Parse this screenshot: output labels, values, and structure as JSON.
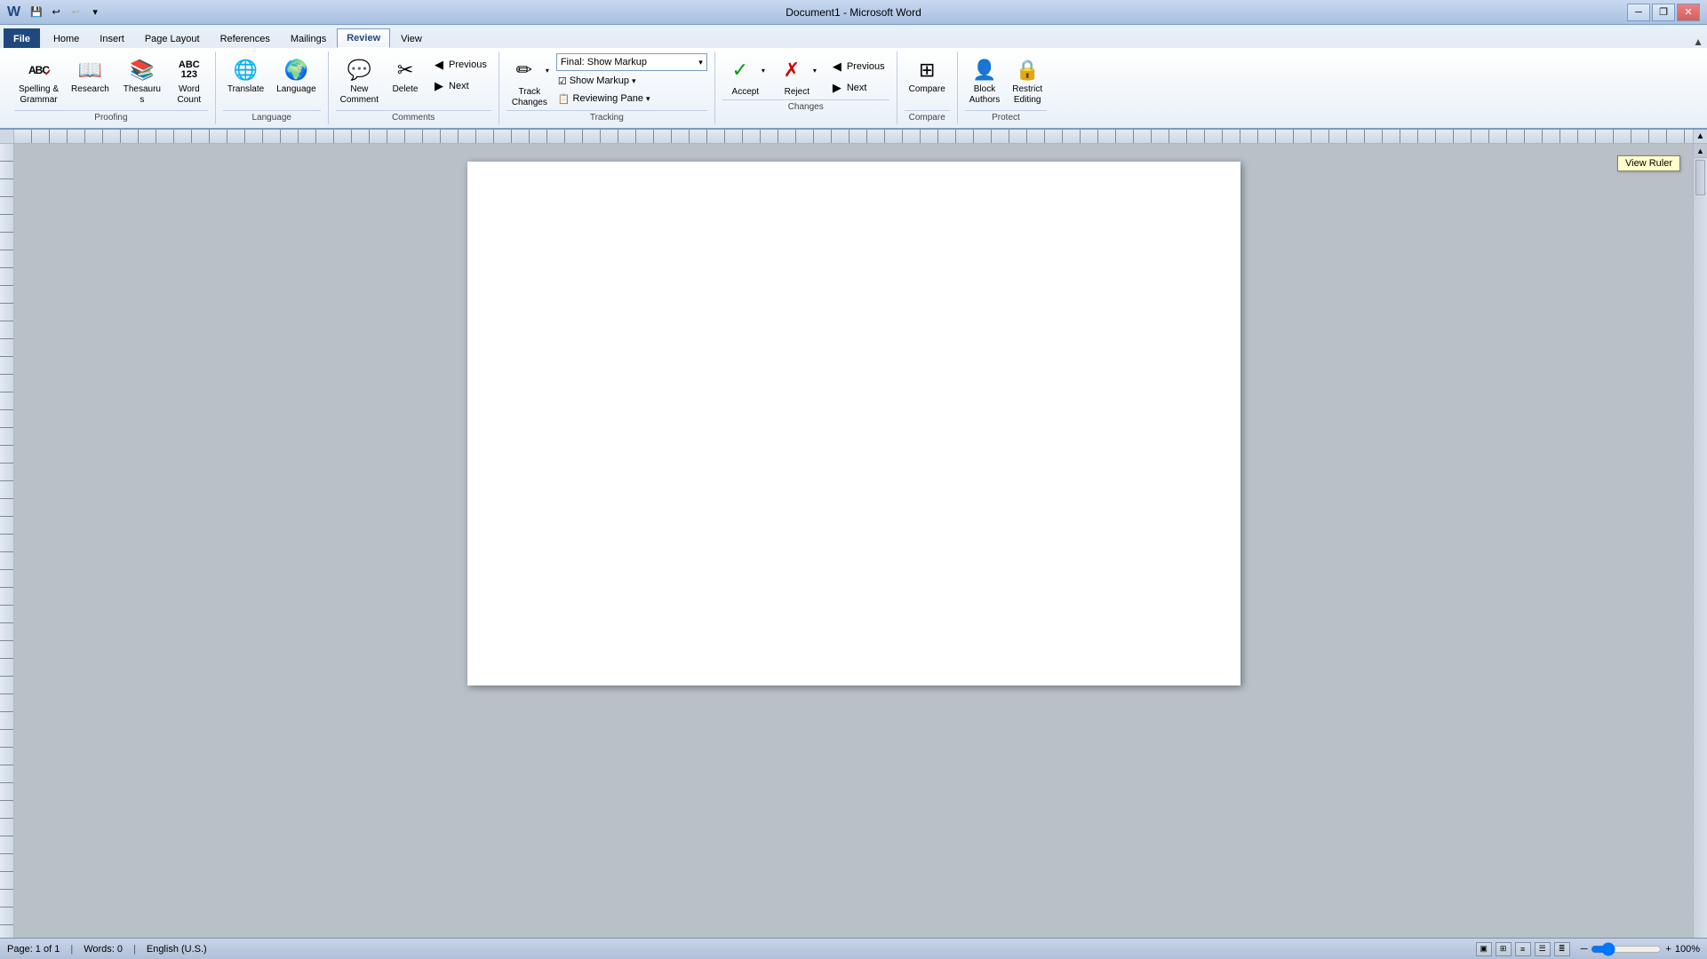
{
  "window": {
    "title": "Document1 - Microsoft Word",
    "minimize_label": "─",
    "restore_label": "❐",
    "close_label": "✕"
  },
  "quickaccess": {
    "save_label": "💾",
    "undo_label": "↩",
    "redo_label": "↪",
    "dropdown_label": "▾"
  },
  "tabs": [
    {
      "id": "file",
      "label": "File"
    },
    {
      "id": "home",
      "label": "Home"
    },
    {
      "id": "insert",
      "label": "Insert"
    },
    {
      "id": "pagelayout",
      "label": "Page Layout"
    },
    {
      "id": "references",
      "label": "References"
    },
    {
      "id": "mailings",
      "label": "Mailings"
    },
    {
      "id": "review",
      "label": "Review"
    },
    {
      "id": "view",
      "label": "View"
    }
  ],
  "active_tab": "Review",
  "ribbon": {
    "proofing_group_label": "Proofing",
    "language_group_label": "Language",
    "comments_group_label": "Comments",
    "tracking_group_label": "Tracking",
    "changes_group_label": "Changes",
    "compare_group_label": "Compare",
    "protect_group_label": "Protect",
    "spelling_label": "Spelling &\nGrammar",
    "research_label": "Research",
    "thesaurus_label": "Thesaurus",
    "word_count_label": "Word\nCount",
    "translate_label": "Translate",
    "language_label": "Language",
    "new_comment_label": "New\nComment",
    "delete_label": "Delete",
    "previous_comment_label": "Previous",
    "next_comment_label": "Next",
    "track_changes_label": "Track\nChanges",
    "markup_dropdown_label": "Final: Show Markup",
    "show_markup_label": "Show Markup",
    "reviewing_pane_label": "Reviewing Pane",
    "accept_label": "Accept",
    "reject_label": "Reject",
    "previous_change_label": "Previous",
    "next_change_label": "Next",
    "compare_label": "Compare",
    "block_authors_label": "Block\nAuthors",
    "restrict_editing_label": "Restrict\nEditing",
    "dropdown_arrow": "▾",
    "markup_arrow": "▾",
    "show_markup_arrow": "▾",
    "reviewing_pane_arrow": "▾"
  },
  "tooltip": {
    "view_ruler": "View Ruler"
  },
  "document": {
    "content": ""
  },
  "statusbar": {
    "page_label": "Page: 1 of 1",
    "words_label": "Words: 0",
    "language_label": "English (U.S.)",
    "zoom_level": "100%",
    "zoom_minus": "─",
    "zoom_plus": "+"
  },
  "icons": {
    "spelling": "ABC✓",
    "research": "📖",
    "thesaurus": "📚",
    "word_count": "123",
    "translate": "🌐",
    "language": "🌍",
    "new_comment": "💬",
    "delete": "🗑",
    "previous": "◀",
    "next": "▶",
    "track_changes": "✎",
    "show_markup": "☑",
    "reviewing_pane": "📋",
    "accept": "✓",
    "reject": "✗",
    "compare": "⊞",
    "block_authors": "🔒",
    "restrict_editing": "🔒",
    "collapse": "▲"
  }
}
